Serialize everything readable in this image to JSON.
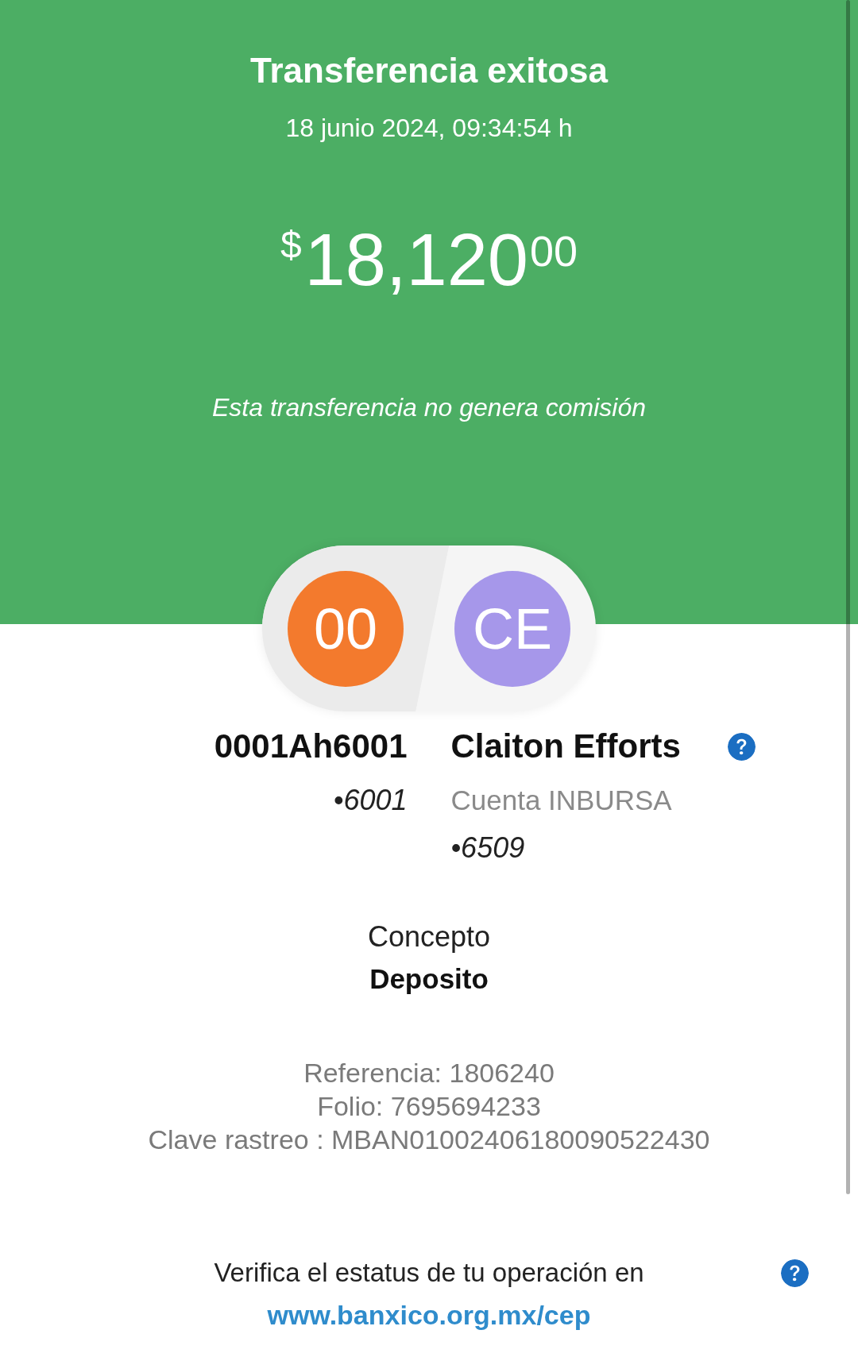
{
  "header": {
    "title": "Transferencia exitosa",
    "datetime": "18 junio 2024, 09:34:54 h",
    "amount": {
      "currency": "$",
      "whole": "18,120",
      "cents": "00"
    },
    "note": "Esta transferencia no genera comisión"
  },
  "parties": [
    {
      "kind": "origin",
      "initials": "00",
      "color": "#f37a2d",
      "name": "0001Ah6001",
      "account": "•6001"
    },
    {
      "kind": "destination",
      "initials": "CE",
      "color": "#a697ea",
      "name": "Claiton Efforts",
      "bank": "Cuenta INBURSA",
      "account": "•6509"
    }
  ],
  "concept": {
    "label": "Concepto",
    "value": "Deposito"
  },
  "references": [
    "Referencia: 1806240",
    "Folio: 7695694233",
    "Clave rastreo : MBAN01002406180090522430"
  ],
  "verify": {
    "text": "Verifica el estatus de tu operación en",
    "link": "www.banxico.org.mx/cep"
  }
}
